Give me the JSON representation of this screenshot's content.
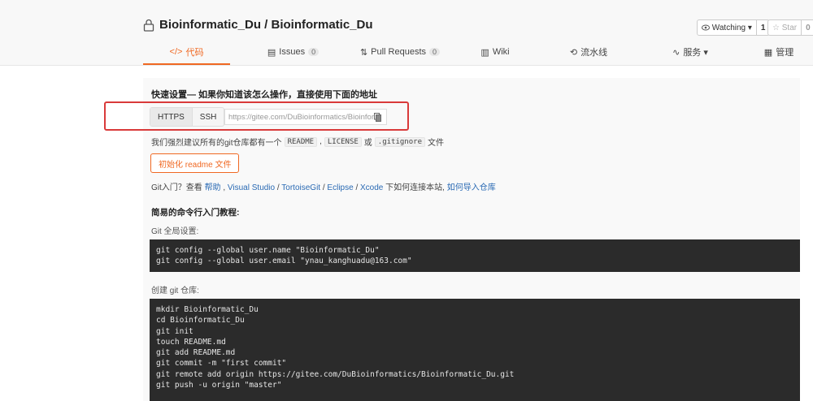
{
  "repo": {
    "title": "Bioinformatic_Du / Bioinformatic_Du"
  },
  "watch": {
    "label": "Watching ▾",
    "count": "1"
  },
  "star": {
    "label": "Star",
    "count": "0"
  },
  "tabs": [
    {
      "label": "代码",
      "icon": "code-icon",
      "active": true
    },
    {
      "label": "Issues",
      "badge": "0",
      "icon": "issues-icon"
    },
    {
      "label": "Pull Requests",
      "badge": "0",
      "icon": "pull-request-icon"
    },
    {
      "label": "Wiki",
      "icon": "wiki-icon"
    },
    {
      "label": "流水线",
      "icon": "pipeline-icon"
    },
    {
      "label": "服务 ▾",
      "icon": "service-icon"
    },
    {
      "label": "管理",
      "icon": "settings-icon"
    }
  ],
  "setup": {
    "title": "快速设置— 如果你知道该怎么操作，直接使用下面的地址",
    "https_label": "HTTPS",
    "ssh_label": "SSH",
    "url": "https://gitee.com/DuBioinformatics/Bioinformatic_Du.git",
    "recommend_prefix": "我们强烈建议所有的git仓库都有一个",
    "readme_chip": "README",
    "license_chip": "LICENSE",
    "gitignore_chip": ".gitignore",
    "recommend_suffix": "文件",
    "sep1": ",",
    "sep2": "或",
    "init_button": "初始化 readme 文件"
  },
  "intro": {
    "prefix": "Git入门？查看",
    "help": "帮助",
    "sep": ",",
    "vs": "Visual Studio",
    "slash": "/",
    "tortoise": "TortoiseGit",
    "eclipse": "Eclipse",
    "xcode": "Xcode",
    "middle": "下如何连接本站,",
    "import": "如何导入仓库"
  },
  "commands": {
    "title": "简易的命令行入门教程:",
    "global_label": "Git 全局设置:",
    "global_code": "git config --global user.name \"Bioinformatic_Du\"\ngit config --global user.email \"ynau_kanghuadu@163.com\"",
    "create_label": "创建 git 仓库:",
    "create_code": "mkdir Bioinformatic_Du\ncd Bioinformatic_Du\ngit init\ntouch README.md\ngit add README.md\ngit commit -m \"first commit\"\ngit remote add origin https://gitee.com/DuBioinformatics/Bioinformatic_Du.git\ngit push -u origin \"master\""
  },
  "colors": {
    "accent": "#f06822",
    "link": "#2a6ab4",
    "highlight": "#d93a3a",
    "code_bg": "#2b2b2b"
  }
}
